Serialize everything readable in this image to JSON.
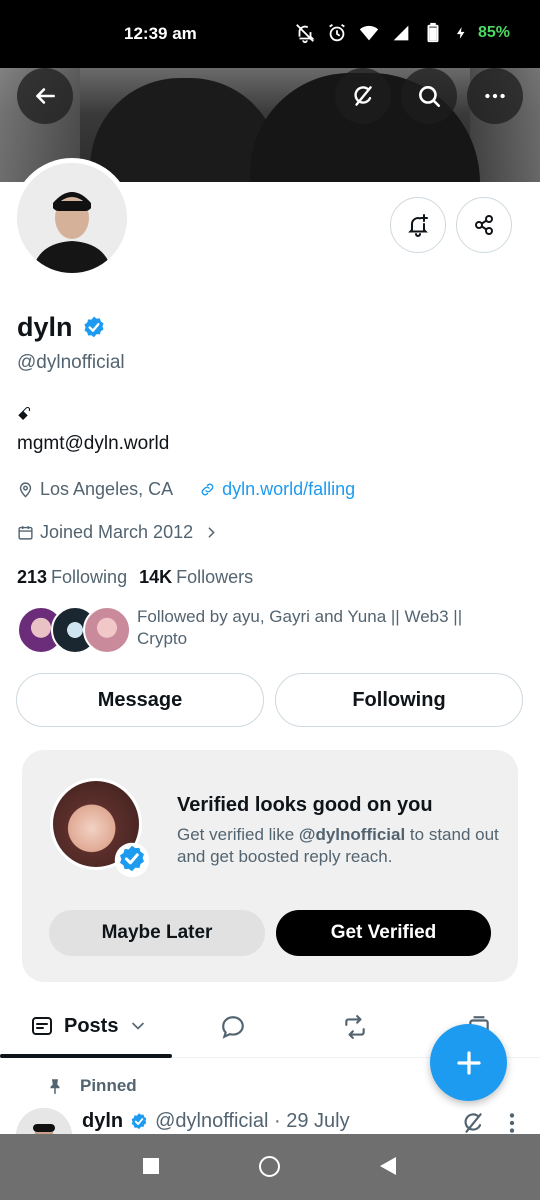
{
  "status_bar": {
    "time": "12:39 am",
    "battery": "85%"
  },
  "profile": {
    "name": "dyln",
    "handle": "@dylnofficial",
    "bio_line1": "ꗃ",
    "bio_line2": "mgmt@dyln.world",
    "location": "Los Angeles, CA",
    "website": "dyln.world/falling",
    "joined": "Joined March 2012",
    "following_count": "213",
    "following_label": "Following",
    "followers_count": "14K",
    "followers_label": "Followers",
    "followed_by": "Followed by ayu, Gayri and Yuna || Web3 || Crypto"
  },
  "buttons": {
    "message": "Message",
    "following": "Following"
  },
  "verify_card": {
    "title": "Verified looks good on you",
    "desc_prefix": "Get verified like ",
    "desc_handle": "@dylnofficial",
    "desc_suffix": " to stand out and get boosted reply reach.",
    "maybe_later": "Maybe Later",
    "get_verified": "Get Verified"
  },
  "tabs": {
    "posts": "Posts"
  },
  "pinned": {
    "label": "Pinned",
    "author_name": "dyln",
    "author_handle_date": "@dylnofficial · 29 July"
  },
  "colors": {
    "accent": "#1d9bf0",
    "verified": "#1d9bf0",
    "battery": "#4cd964"
  }
}
